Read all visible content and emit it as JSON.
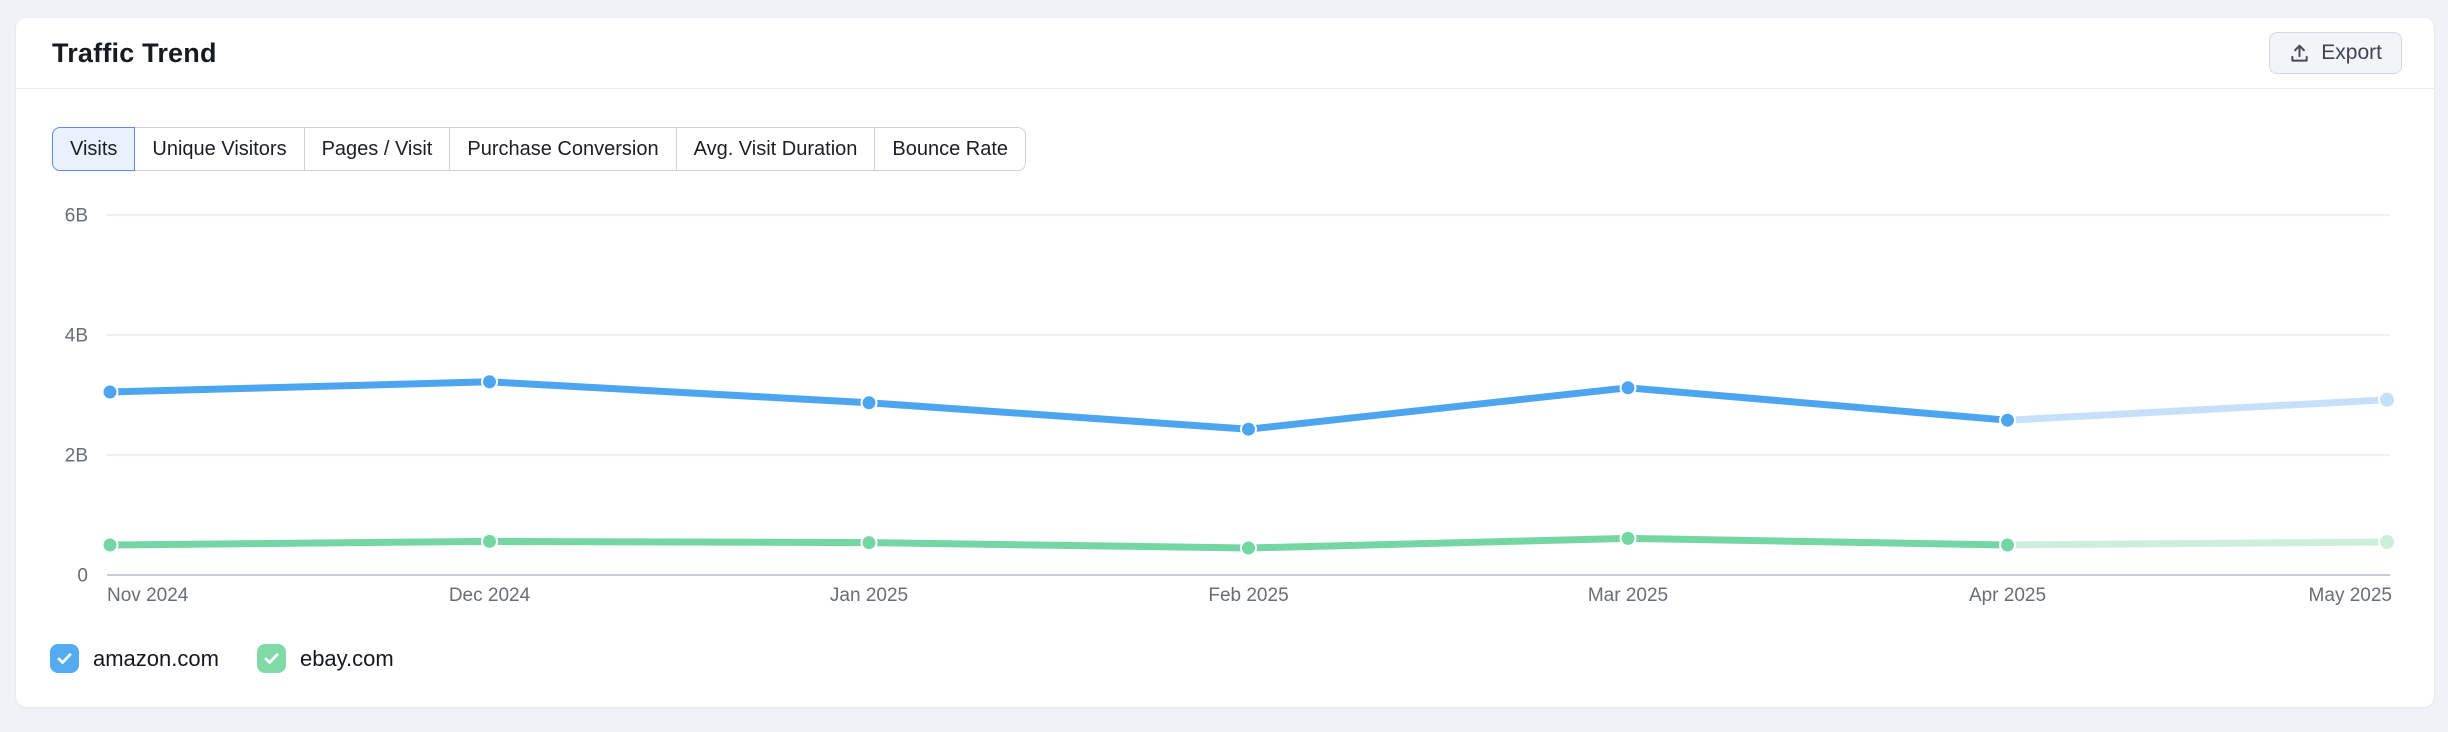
{
  "header": {
    "title": "Traffic Trend",
    "export_label": "Export"
  },
  "tabs": [
    {
      "label": "Visits",
      "selected": true
    },
    {
      "label": "Unique Visitors",
      "selected": false
    },
    {
      "label": "Pages / Visit",
      "selected": false
    },
    {
      "label": "Purchase Conversion",
      "selected": false
    },
    {
      "label": "Avg. Visit Duration",
      "selected": false
    },
    {
      "label": "Bounce Rate",
      "selected": false
    }
  ],
  "chart_data": {
    "type": "line",
    "title": "Traffic Trend",
    "selected_metric": "Visits",
    "x": [
      "Nov 2024",
      "Dec 2024",
      "Jan 2025",
      "Feb 2025",
      "Mar 2025",
      "Apr 2025",
      "May 2025"
    ],
    "unit": "billions of visits",
    "series": [
      {
        "name": "amazon.com",
        "color": "#4da5f0",
        "faded_color": "#c6e0f9",
        "values": [
          3.05,
          3.22,
          2.87,
          2.43,
          3.12,
          2.58,
          2.92
        ]
      },
      {
        "name": "ebay.com",
        "color": "#74d6a3",
        "faded_color": "#cdeeda",
        "values": [
          0.5,
          0.56,
          0.54,
          0.45,
          0.61,
          0.5,
          0.55
        ]
      }
    ],
    "yticks": {
      "labels": [
        "6B",
        "4B",
        "2B",
        "0"
      ],
      "values": [
        6,
        4,
        2,
        0
      ]
    },
    "ylim": [
      0,
      6
    ],
    "grid": "horizontal",
    "legend_position": "bottom-left",
    "faded_last_segment": true
  },
  "legend": [
    {
      "label": "amazon.com",
      "color": "#54abf0",
      "checked": true
    },
    {
      "label": "ebay.com",
      "color": "#7fdaa8",
      "checked": true
    }
  ],
  "colors": {
    "page_bg": "#f0f2f7",
    "card_bg": "#ffffff",
    "gridline": "#edeff4",
    "zero_line": "#c9cdd5",
    "tab_selected_bg": "#e9f1fd",
    "tab_selected_border": "#5b8ce8"
  }
}
